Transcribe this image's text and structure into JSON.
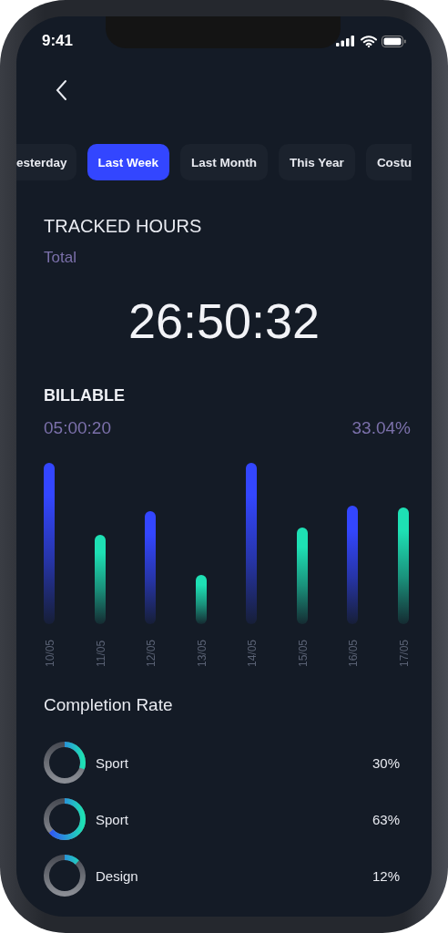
{
  "status_bar": {
    "time": "9:41"
  },
  "tabs": [
    {
      "label": "esterday",
      "selected": false
    },
    {
      "label": "Last Week",
      "selected": true
    },
    {
      "label": "Last Month",
      "selected": false
    },
    {
      "label": "This Year",
      "selected": false
    },
    {
      "label": "Costu",
      "selected": false
    }
  ],
  "tracked": {
    "title": "TRACKED HOURS",
    "subtitle": "Total",
    "value": "26:50:32"
  },
  "billable": {
    "title": "BILLABLE",
    "time": "05:00:20",
    "percent": "33.04%",
    "bars": [
      {
        "date": "10/05",
        "color": "#3346ff"
      },
      {
        "date": "11/05",
        "color": "#1ee0b4"
      },
      {
        "date": "12/05",
        "color": "#3346ff"
      },
      {
        "date": "13/05",
        "color": "#1ee0b4"
      },
      {
        "date": "14/05",
        "color": "#3346ff"
      },
      {
        "date": "15/05",
        "color": "#1ee0b4"
      },
      {
        "date": "16/05",
        "color": "#3346ff"
      },
      {
        "date": "17/05",
        "color": "#1ee0b4"
      }
    ]
  },
  "completion": {
    "title": "Completion Rate",
    "items": [
      {
        "name": "Sport",
        "value": "30%",
        "level": 0.3
      },
      {
        "name": "Sport",
        "value": "63%",
        "level": 0.63
      },
      {
        "name": "Design",
        "value": "12%",
        "level": 0.12
      }
    ]
  }
}
